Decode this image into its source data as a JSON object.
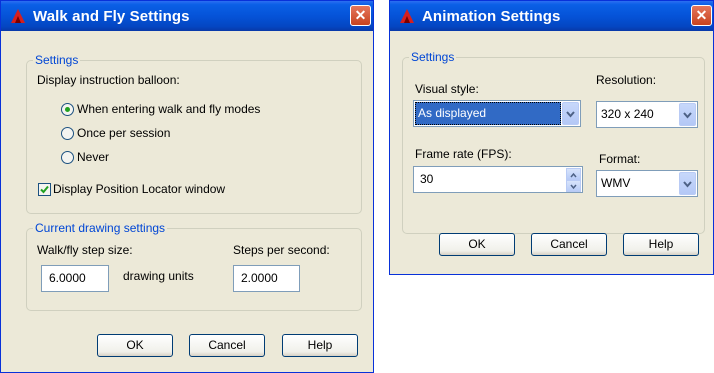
{
  "walk_fly_dialog": {
    "title": "Walk and Fly Settings",
    "close_label": "✕",
    "settings_group": {
      "legend": "Settings",
      "balloon_label": "Display instruction balloon:",
      "options": [
        {
          "label": "When entering walk and fly modes",
          "selected": true
        },
        {
          "label": "Once per session",
          "selected": false
        },
        {
          "label": "Never",
          "selected": false
        }
      ],
      "position_locator": {
        "label": "Display Position Locator window",
        "checked": true
      }
    },
    "drawing_group": {
      "legend": "Current drawing settings",
      "step_size_label": "Walk/fly step size:",
      "step_size_value": "6.0000",
      "units_label": "drawing units",
      "steps_per_second_label": "Steps per second:",
      "steps_per_second_value": "2.0000"
    },
    "buttons": {
      "ok": "OK",
      "cancel": "Cancel",
      "help": "Help"
    }
  },
  "animation_dialog": {
    "title": "Animation Settings",
    "close_label": "✕",
    "settings_group": {
      "legend": "Settings",
      "visual_style_label": "Visual style:",
      "visual_style_value": "As displayed",
      "resolution_label": "Resolution:",
      "resolution_value": "320 x 240",
      "frame_rate_label": "Frame rate (FPS):",
      "frame_rate_value": "30",
      "format_label": "Format:",
      "format_value": "WMV"
    },
    "buttons": {
      "ok": "OK",
      "cancel": "Cancel",
      "help": "Help"
    }
  },
  "colors": {
    "title_bar": "#0553d8",
    "dialog_bg": "#ece9d8",
    "group_legend": "#0046d5",
    "selection": "#316ac5",
    "close_button": "#d05a36"
  },
  "icons": [
    "autocad-app-icon",
    "close-icon",
    "radio-icon",
    "checkbox-check-icon",
    "dropdown-arrow-icon",
    "spin-up-icon",
    "spin-down-icon"
  ]
}
